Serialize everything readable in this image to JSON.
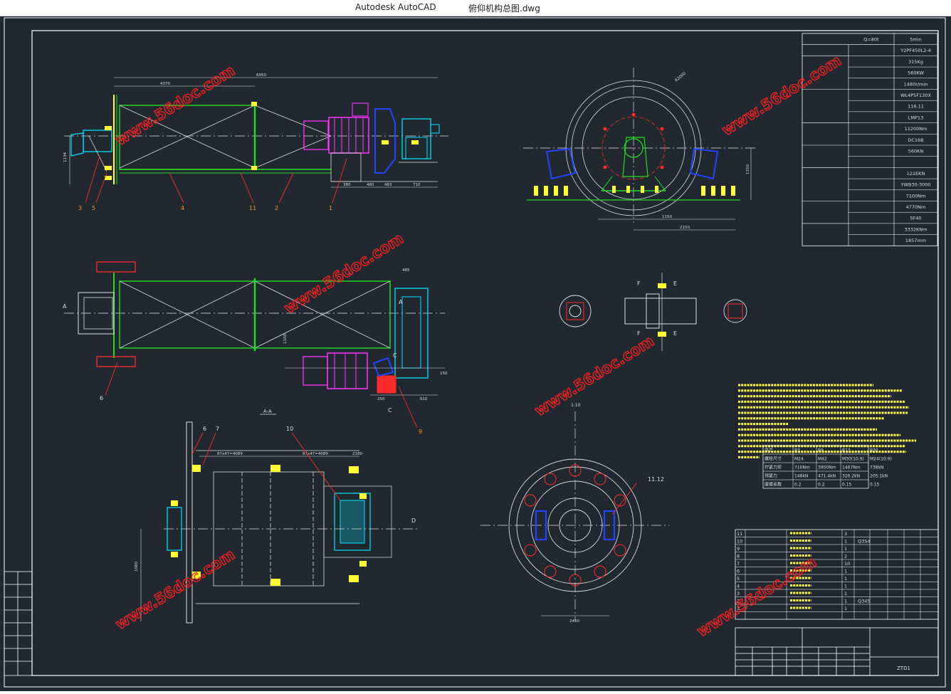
{
  "window": {
    "app_name": "Autodesk AutoCAD",
    "file_name": "俯仰机构总图.dwg"
  },
  "watermark": "www.56doc.com",
  "colors": {
    "background": "#212830",
    "frame": "#ffffff",
    "green": "#22dd22",
    "magenta": "#ff33ff",
    "cyan": "#00e5ff",
    "red": "#ff2a2a",
    "yellow": "#ffff33",
    "blue": "#2244ff"
  },
  "section_label": "A-A",
  "scale_label": "1:10",
  "params": [
    {
      "label": "",
      "value": "Q=80t",
      "value2": "5min"
    },
    {
      "label": "",
      "value": "",
      "value2": "Y2PF450L2-4"
    },
    {
      "label": "",
      "value": "",
      "value2": "315Kg"
    },
    {
      "label": "",
      "value": "",
      "value2": "560KW"
    },
    {
      "label": "",
      "value": "",
      "value2": "1480r/min"
    },
    {
      "label": "",
      "value": "",
      "value2": "WL4P5F130X"
    },
    {
      "label": "",
      "value": "",
      "value2": "116.11"
    },
    {
      "label": "",
      "value": "",
      "value2": "LMP13"
    },
    {
      "label": "",
      "value": "",
      "value2": "11200Nm"
    },
    {
      "label": "",
      "value": "",
      "value2": "DC16B"
    },
    {
      "label": "",
      "value": "",
      "value2": "560KN"
    },
    {
      "label": "",
      "value": "",
      "value2": ""
    },
    {
      "label": "",
      "value": "",
      "value2": "122EKN"
    },
    {
      "label": "",
      "value": "",
      "value2": "YWB30-3000"
    },
    {
      "label": "",
      "value": "",
      "value2": "7100Nm"
    },
    {
      "label": "",
      "value": "",
      "value2": "4770Nm"
    },
    {
      "label": "",
      "value": "",
      "value2": "SF40"
    },
    {
      "label": "",
      "value": "",
      "value2": "3332KNm"
    },
    {
      "label": "",
      "value": "",
      "value2": "1857mm"
    }
  ],
  "bolt_table": {
    "header": [
      "序号",
      "B3",
      "B9",
      "B13",
      "B30"
    ],
    "rows": [
      [
        "螺栓尺寸",
        "M24",
        "M42",
        "M30(10.9)",
        "M24(10.9)"
      ],
      [
        "拧紧力矩",
        "710Nm",
        "3950Nm",
        "1467Nm",
        "738kN"
      ],
      [
        "预紧力",
        "148kN",
        "471.4kN",
        "326.2kN",
        "205.1kN"
      ],
      [
        "摩擦系数",
        "0.2",
        "0.2",
        "0.15",
        "0.15"
      ]
    ]
  },
  "bom": [
    {
      "no": "11",
      "qty": "3",
      "mat": ""
    },
    {
      "no": "10",
      "qty": "1",
      "mat": "Q3S4"
    },
    {
      "no": "9",
      "qty": "1",
      "mat": ""
    },
    {
      "no": "8",
      "qty": "2",
      "mat": ""
    },
    {
      "no": "7",
      "qty": "10",
      "mat": ""
    },
    {
      "no": "6",
      "qty": "1",
      "mat": ""
    },
    {
      "no": "5",
      "qty": "1",
      "mat": ""
    },
    {
      "no": "4",
      "qty": "1",
      "mat": ""
    },
    {
      "no": "3",
      "qty": "1",
      "mat": ""
    },
    {
      "no": "2",
      "qty": "1",
      "mat": "Q345"
    },
    {
      "no": "1",
      "qty": "1",
      "mat": ""
    }
  ],
  "title_block": {
    "drawing_no": "ZTD1"
  },
  "callouts": {
    "front": [
      "3",
      "5",
      "4",
      "11",
      "2",
      "1"
    ],
    "plan": [
      "6",
      "9"
    ],
    "section": [
      "6",
      "7",
      "10"
    ],
    "drum": "11.12"
  },
  "section_markers": [
    "A",
    "A",
    "C",
    "C",
    "D",
    "E",
    "E",
    "F",
    "F"
  ],
  "dims": {
    "overall": "6950",
    "span": "4370",
    "height": "1134",
    "base": "380",
    "d1": "480",
    "d2": "483",
    "d3": "710",
    "sheave_r": "R2000",
    "w1": "1150",
    "w2": "2150",
    "h_sheave": "1150",
    "plan_top": "485",
    "plan_right": "150",
    "plan_d1": "250",
    "plan_d2": "610",
    "plan_h": "1100",
    "sec_a": "87x47=4089",
    "sec_b": "87x47=4089",
    "sec_c": "2180",
    "sec_h": "1080",
    "drum_w": "2450"
  }
}
